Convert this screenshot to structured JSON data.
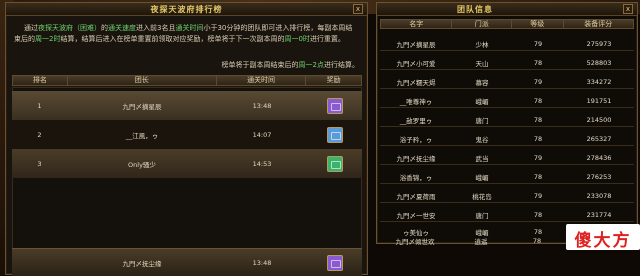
{
  "left": {
    "title": "夜探天波府排行榜",
    "close": "x",
    "intro": {
      "p1": "通过",
      "dungeon": "夜探天波府（困难）",
      "p2": "的",
      "speed": "通关速度",
      "p3": "进入前3名且",
      "time": "通关时间",
      "p4": "小于30分钟的团队即可进入排行榜，每副本周结束后的",
      "week1": "周一2时",
      "p5": "结算，结算后进入在榜单重置前领取对应奖励，榜单将于下一次副本周的",
      "week2": "周一0时",
      "p6": "进行重置。"
    },
    "note": {
      "p1": "榜单将于副本周结束后的",
      "week": "周一2点",
      "p2": "进行结算。"
    },
    "headers": [
      "排名",
      "团长",
      "通关时间",
      "奖励"
    ],
    "rows": [
      {
        "rank": "1",
        "leader": "九門〆摘星辰",
        "time": "13:48"
      },
      {
        "rank": "2",
        "leader": "__江風，ゥ",
        "time": "14:07"
      },
      {
        "rank": "3",
        "leader": "Only骚少",
        "time": "14:53"
      }
    ],
    "my_row": {
      "leader": "九門〆抚尘缘",
      "time": "13:48"
    },
    "reward_colors": [
      "#8a5ad0",
      "#5a9ad8",
      "#3ab46a",
      "#8a5ad0"
    ]
  },
  "right": {
    "title": "团队信息",
    "close": "x",
    "headers": [
      "名字",
      "门派",
      "等级",
      "装备评分"
    ],
    "rows": [
      {
        "name": "九門〆摘星辰",
        "school": "少林",
        "level": "79",
        "score": "275973"
      },
      {
        "name": "九門〆小可爱",
        "school": "天山",
        "level": "78",
        "score": "528803"
      },
      {
        "name": "九門〆糯天烬",
        "school": "慕容",
        "level": "79",
        "score": "334272"
      },
      {
        "name": "__唯尊神ゥ",
        "school": "峨嵋",
        "level": "78",
        "score": "191751"
      },
      {
        "name": "__敌罗里ゥ",
        "school": "唐门",
        "level": "78",
        "score": "214500"
      },
      {
        "name": "浴子矜，ゥ",
        "school": "鬼谷",
        "level": "78",
        "score": "265327"
      },
      {
        "name": "九門〆抚尘缘",
        "school": "武当",
        "level": "79",
        "score": "278436"
      },
      {
        "name": "浴香锦，ゥ",
        "school": "峨嵋",
        "level": "78",
        "score": "276253"
      },
      {
        "name": "九門〆夏荷雨",
        "school": "桃花岛",
        "level": "79",
        "score": "233078"
      },
      {
        "name": "九門〆一世安",
        "school": "唐门",
        "level": "78",
        "score": "231774"
      },
      {
        "name": "ゥ美仙ゥ",
        "school": "峨嵋",
        "level": "78",
        "score": "266762"
      },
      {
        "name": "九門〆倾世欢",
        "school": "逍遥",
        "level": "78",
        "score": "22"
      }
    ]
  },
  "watermark": "傻大方"
}
